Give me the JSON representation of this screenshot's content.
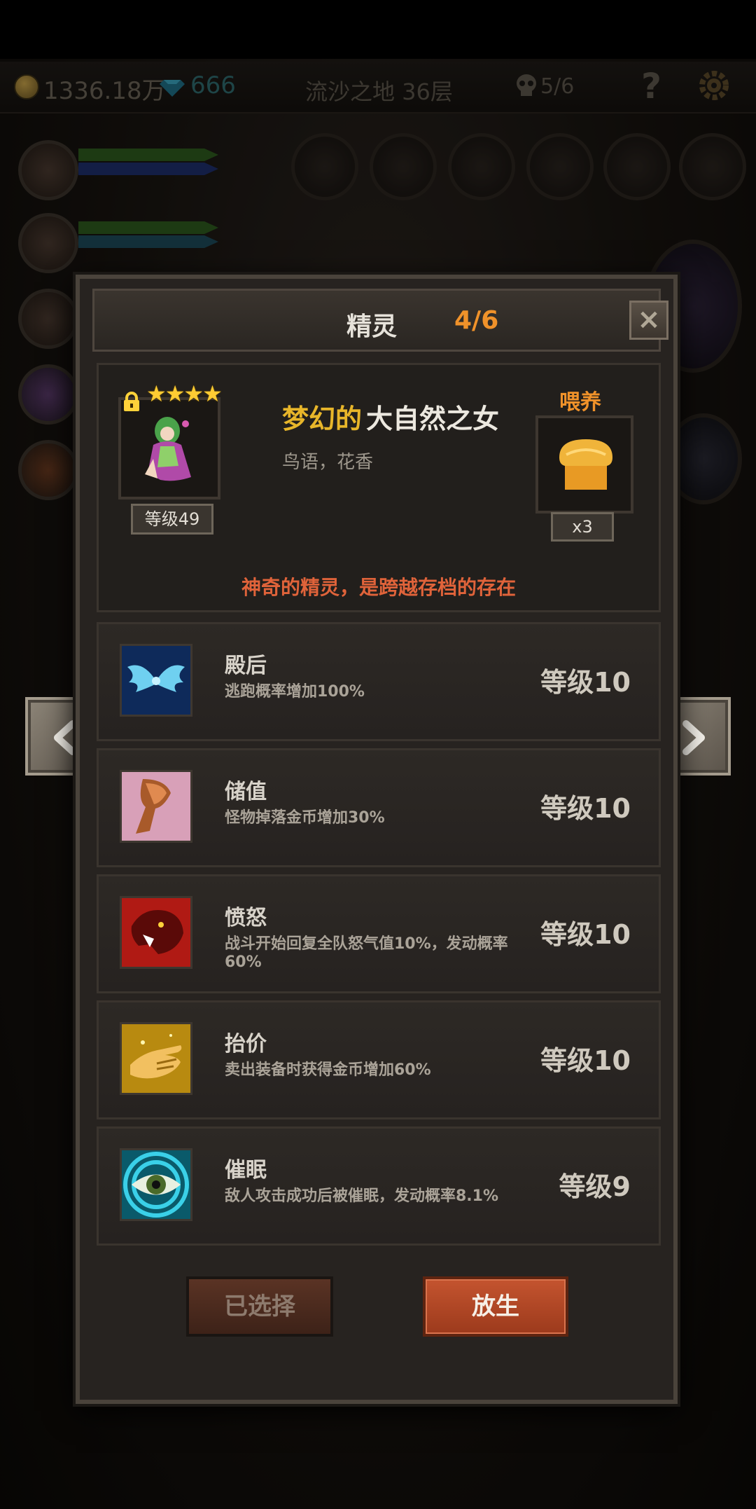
{
  "hud": {
    "coins": "1336.18万",
    "gems": "666",
    "stage": "流沙之地 36层",
    "deaths": "5/6",
    "help": "?"
  },
  "modal": {
    "title": "精灵",
    "count": "4/6",
    "close": "×"
  },
  "spirit": {
    "stars": "★★★★",
    "level": "等级49",
    "name_prefix": "梦幻的",
    "name": "大自然之女",
    "description": "鸟语，花香",
    "feed_label": "喂养",
    "feed_count": "x3",
    "note": "神奇的精灵，是跨越存档的存在"
  },
  "skills": [
    {
      "name": "殿后",
      "desc": "逃跑概率增加100%",
      "level": "等级10",
      "icon": "wings-icon"
    },
    {
      "name": "储值",
      "desc": "怪物掉落金币增加30%",
      "level": "等级10",
      "icon": "goblet-icon"
    },
    {
      "name": "愤怒",
      "desc": "战斗开始回复全队怒气值10%，发动概率60%",
      "level": "等级10",
      "icon": "panther-icon"
    },
    {
      "name": "抬价",
      "desc": "卖出装备时获得金币增加60%",
      "level": "等级10",
      "icon": "hand-icon"
    },
    {
      "name": "催眠",
      "desc": "敌人攻击成功后被催眠，发动概率8.1%",
      "level": "等级9",
      "icon": "eye-icon"
    }
  ],
  "buttons": {
    "selected": "已选择",
    "release": "放生"
  },
  "colors": {
    "accent_orange": "#f0922a",
    "note_red": "#e0633a",
    "name_gold": "#e8b62a",
    "release_button": "#b84a28"
  }
}
